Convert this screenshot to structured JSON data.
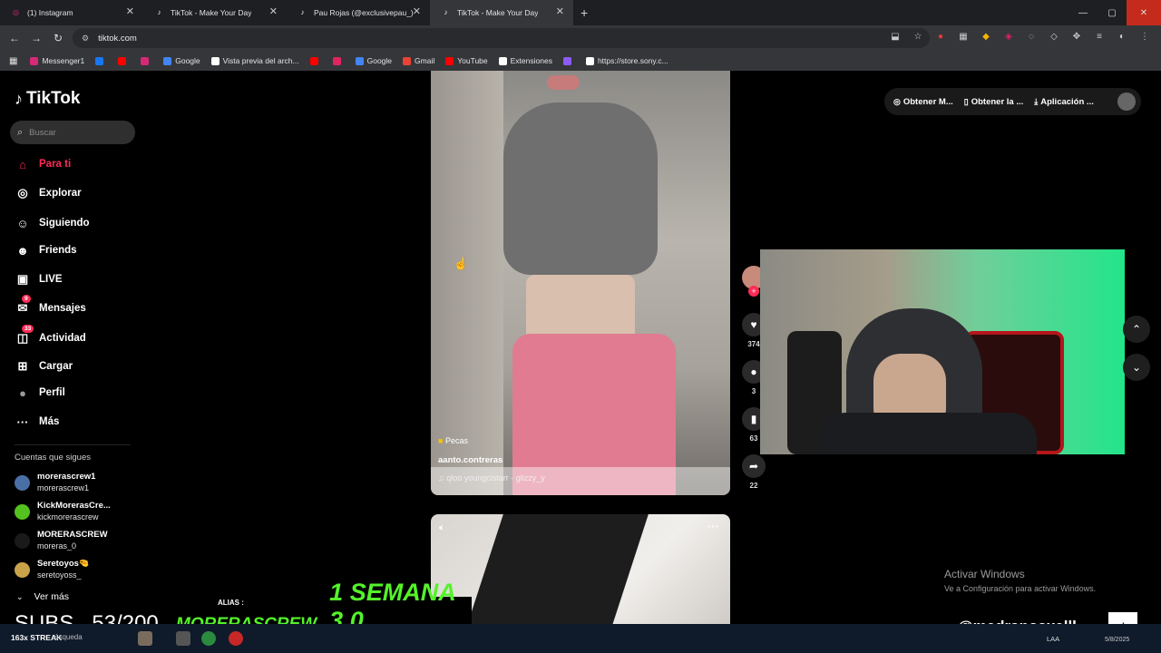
{
  "tabs": [
    {
      "title": "(1) Instagram",
      "fav": "instagram-icon",
      "color": "#d62976"
    },
    {
      "title": "TikTok - Make Your Day",
      "fav": "tiktok-icon",
      "color": "#000000"
    },
    {
      "title": "Pau Rojas (@exclusivepau_) | Ti",
      "fav": "tiktok-icon",
      "color": "#000000"
    },
    {
      "title": "TikTok - Make Your Day",
      "fav": "tiktok-icon",
      "color": "#000000"
    }
  ],
  "address": {
    "url": "tiktok.com"
  },
  "bookmarks": [
    {
      "label": "Messenger1",
      "color": "#d62976"
    },
    {
      "label": "",
      "color": "#1877f2"
    },
    {
      "label": "",
      "color": "#ff0000"
    },
    {
      "label": "",
      "color": "#d62976"
    },
    {
      "label": "Google",
      "color": "#4285f4"
    },
    {
      "label": "Vista previa del arch...",
      "color": "#ffffff"
    },
    {
      "label": "",
      "color": "#ff0000"
    },
    {
      "label": "",
      "color": "#e0245e"
    },
    {
      "label": "Google",
      "color": "#4285f4"
    },
    {
      "label": "Gmail",
      "color": "#ea4335"
    },
    {
      "label": "YouTube",
      "color": "#ff0000"
    },
    {
      "label": "Extensiones",
      "color": "#ffffff"
    },
    {
      "label": "",
      "color": "#8b5cf6"
    },
    {
      "label": "https://store.sony.c...",
      "color": "#ffffff"
    }
  ],
  "sidebar": {
    "logo": "TikTok",
    "search_placeholder": "Buscar",
    "nav": [
      {
        "label": "Para ti",
        "icon": "home-icon",
        "glyph": "⌂",
        "active": true
      },
      {
        "label": "Explorar",
        "icon": "compass-icon",
        "glyph": "◎"
      },
      {
        "label": "Siguiendo",
        "icon": "following-icon",
        "glyph": "☺"
      },
      {
        "label": "Friends",
        "icon": "friends-icon",
        "glyph": "☻"
      },
      {
        "label": "LIVE",
        "icon": "live-icon",
        "glyph": "▣"
      },
      {
        "label": "Mensajes",
        "icon": "messages-icon",
        "glyph": "✉",
        "badge": "9"
      },
      {
        "label": "Actividad",
        "icon": "activity-icon",
        "glyph": "◫",
        "badge": "33"
      },
      {
        "label": "Cargar",
        "icon": "upload-icon",
        "glyph": "⊞"
      },
      {
        "label": "Perfil",
        "icon": "profile-avatar",
        "glyph": "●"
      },
      {
        "label": "Más",
        "icon": "more-icon",
        "glyph": "···"
      }
    ],
    "following_title": "Cuentas que sigues",
    "accounts": [
      {
        "name": "morerascrew1",
        "handle": "morerascrew1",
        "color": "#4a6fa5"
      },
      {
        "name": "KickMorerasCre...",
        "handle": "kickmorerascrew",
        "color": "#53c21f"
      },
      {
        "name": "MORERASCREW",
        "handle": "moreras_0",
        "color": "#1a1a1a"
      },
      {
        "name": "Seretoyos🤏",
        "handle": "seretoyoss_",
        "color": "#c9a34a"
      }
    ],
    "more_label": "Ver más"
  },
  "video1": {
    "caption": "Pecas",
    "user": "aanto.contreras",
    "music": "♫ qloo youngcistarr - glizzy_y"
  },
  "actions": [
    {
      "icon": "like-icon",
      "glyph": "♥",
      "count": "374"
    },
    {
      "icon": "comment-icon",
      "glyph": "●",
      "count": "3"
    },
    {
      "icon": "bookmark-icon",
      "glyph": "▮",
      "count": "63"
    },
    {
      "icon": "share-icon",
      "glyph": "➦",
      "count": "22"
    }
  ],
  "topbar": {
    "coins": "Obtener M...",
    "app": "Obtener la ...",
    "download": "Aplicación ..."
  },
  "overlay": {
    "subs": "SUBS   53/200",
    "alias": "ALIAS :",
    "name": "MORERASCREW",
    "event": "1 SEMANA 3.0",
    "handle": "@medranoaxelll",
    "windows_1": "Activar Windows",
    "windows_2": "Ve a Configuración para activar Windows."
  },
  "taskbar": {
    "streak": "163x STREAK",
    "search": "úsqueda",
    "lang": "LAA",
    "date": "5/8/2025"
  }
}
